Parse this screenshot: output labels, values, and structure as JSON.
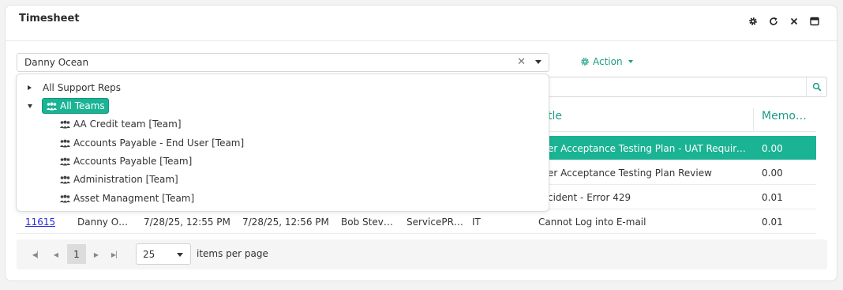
{
  "header": {
    "title": "Timesheet",
    "icons": [
      "gear-icon",
      "refresh-icon",
      "close-icon",
      "window-icon"
    ]
  },
  "filter": {
    "selected": "Danny Ocean",
    "clear": "✕"
  },
  "action": {
    "label": "Action"
  },
  "tree": {
    "items": [
      {
        "label": "All Support Reps",
        "expanded": false
      },
      {
        "label": "All Teams",
        "expanded": true,
        "selected": true
      }
    ],
    "teams": [
      "AA Credit team [Team]",
      "Accounts Payable - End User [Team]",
      "Accounts Payable [Team]",
      "Administration [Team]",
      "Asset Managment [Team]"
    ]
  },
  "grid": {
    "columns": [
      "…tle",
      "Memo…"
    ],
    "rows": [
      {
        "title": "…er Acceptance Testing Plan - UAT Require…",
        "memo": "0.00",
        "selected": true
      },
      {
        "title": "…er Acceptance Testing Plan Review",
        "memo": "0.00"
      },
      {
        "title": "…cident - Error 429",
        "memo": "0.01"
      },
      {
        "id": "11615",
        "user": "Danny O…",
        "start": "7/28/25, 12:55 PM",
        "end": "7/28/25, 12:56 PM",
        "rep": "Bob Stev…",
        "source": "ServicePR…",
        "dept": "IT",
        "title": "Cannot Log into E-mail",
        "memo": "0.01"
      }
    ]
  },
  "pager": {
    "page": "1",
    "page_size": "25",
    "label": "items per page"
  },
  "colors": {
    "accent": "#1ab394",
    "accent_text": "#1a9d86",
    "link": "#2a2ad8"
  }
}
